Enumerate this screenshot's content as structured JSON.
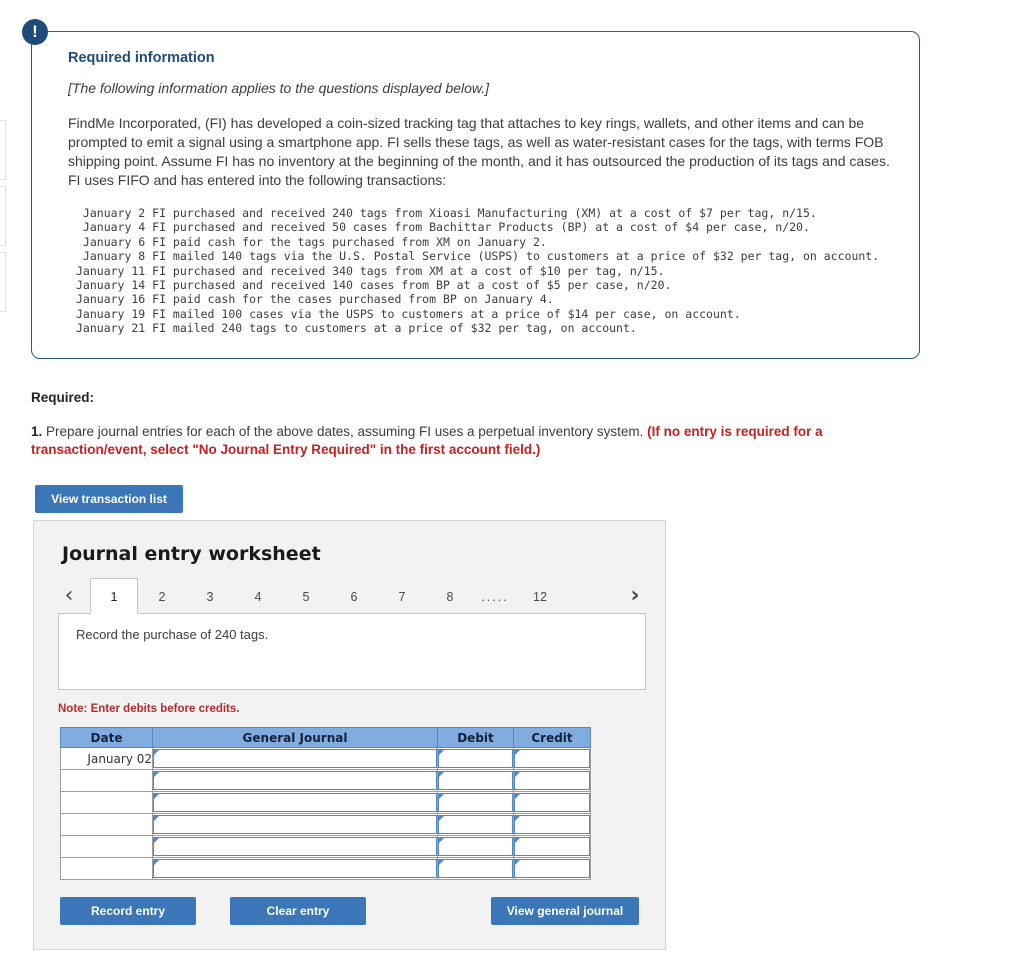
{
  "alert": {
    "icon": "exclamation-icon",
    "glyph": "!"
  },
  "required_information": {
    "title": "Required information",
    "subtitle": "[The following information applies to the questions displayed below.]",
    "body": "FindMe Incorporated, (FI) has developed a coin-sized tracking tag that attaches to key rings, wallets, and other items and can be prompted to emit a signal using a smartphone app. FI sells these tags, as well as water-resistant cases for the tags, with terms FOB shipping point. Assume FI has no inventory at the beginning of the month, and it has outsourced the production of its tags and cases. FI uses FIFO and has entered into the following transactions:",
    "transactions": [
      " January 2 FI purchased and received 240 tags from Xioasi Manufacturing (XM) at a cost of $7 per tag, n/15.",
      " January 4 FI purchased and received 50 cases from Bachittar Products (BP) at a cost of $4 per case, n/20.",
      " January 6 FI paid cash for the tags purchased from XM on January 2.",
      " January 8 FI mailed 140 tags via the U.S. Postal Service (USPS) to customers at a price of $32 per tag, on account.",
      "January 11 FI purchased and received 340 tags from XM at a cost of $10 per tag, n/15.",
      "January 14 FI purchased and received 140 cases from BP at a cost of $5 per case, n/20.",
      "January 16 FI paid cash for the cases purchased from BP on January 4.",
      "January 19 FI mailed 100 cases via the USPS to customers at a price of $14 per case, on account.",
      "January 21 FI mailed 240 tags to customers at a price of $32 per tag, on account."
    ]
  },
  "required_section": {
    "label": "Required:",
    "item_number": "1.",
    "item_text": "Prepare journal entries for each of the above dates, assuming FI uses a perpetual inventory system. ",
    "item_emphasis": "(If no entry is required for a transaction/event, select \"No Journal Entry Required\" in the first account field.)"
  },
  "buttons": {
    "view_transaction_list": "View transaction list",
    "record_entry": "Record entry",
    "clear_entry": "Clear entry",
    "view_general_journal": "View general journal"
  },
  "worksheet": {
    "title": "Journal entry worksheet",
    "pager": {
      "prev_icon": "chevron-left-icon",
      "next_icon": "chevron-right-icon",
      "prev_glyph": "‹",
      "next_glyph": "›",
      "pages": [
        "1",
        "2",
        "3",
        "4",
        "5",
        "6",
        "7",
        "8",
        ".....",
        "12"
      ],
      "active_page": "1"
    },
    "prompt": "Record the purchase of 240 tags.",
    "note": "Note: Enter debits before credits.",
    "table": {
      "headers": [
        "Date",
        "General Journal",
        "Debit",
        "Credit"
      ],
      "rows": [
        {
          "date": "January 02",
          "general_journal": "",
          "debit": "",
          "credit": ""
        },
        {
          "date": "",
          "general_journal": "",
          "debit": "",
          "credit": ""
        },
        {
          "date": "",
          "general_journal": "",
          "debit": "",
          "credit": ""
        },
        {
          "date": "",
          "general_journal": "",
          "debit": "",
          "credit": ""
        },
        {
          "date": "",
          "general_journal": "",
          "debit": "",
          "credit": ""
        },
        {
          "date": "",
          "general_journal": "",
          "debit": "",
          "credit": ""
        }
      ]
    }
  },
  "colors": {
    "accent_blue": "#3a76b8",
    "navy": "#1f4b7a",
    "table_header_blue": "#80ace0",
    "red": "#c32222",
    "note_red": "#b03030"
  }
}
